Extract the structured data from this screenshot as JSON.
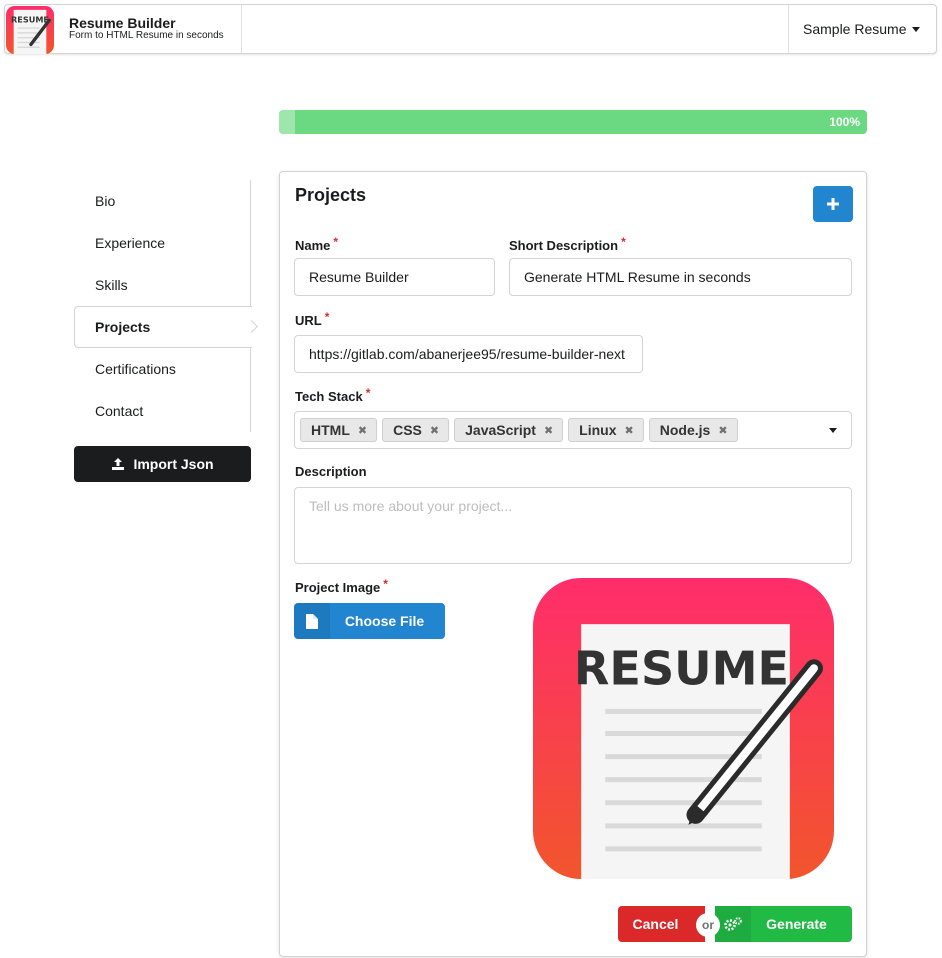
{
  "header": {
    "title": "Resume Builder",
    "subtitle": "Form to HTML Resume in seconds",
    "sample_menu": "Sample Resume",
    "logo_text": "RESUME"
  },
  "progress": {
    "value": 100,
    "label": "100%"
  },
  "sidebar": {
    "items": [
      {
        "label": "Bio"
      },
      {
        "label": "Experience"
      },
      {
        "label": "Skills"
      },
      {
        "label": "Projects",
        "active": true
      },
      {
        "label": "Certifications"
      },
      {
        "label": "Contact"
      }
    ],
    "import_label": "Import Json"
  },
  "form": {
    "title": "Projects",
    "name_label": "Name",
    "name_value": "Resume Builder",
    "short_desc_label": "Short Description",
    "short_desc_value": "Generate HTML Resume in seconds",
    "url_label": "URL",
    "url_value": "https://gitlab.com/abanerjee95/resume-builder-next",
    "tech_label": "Tech Stack",
    "tech_tags": [
      "HTML",
      "CSS",
      "JavaScript",
      "Linux",
      "Node.js"
    ],
    "description_label": "Description",
    "description_placeholder": "Tell us more about your project...",
    "image_label": "Project Image",
    "choose_file_label": "Choose File",
    "required_mark": "*"
  },
  "actions": {
    "cancel": "Cancel",
    "or": "or",
    "generate": "Generate"
  },
  "colors": {
    "primary": "#2185d0",
    "success": "#21ba45",
    "danger": "#db2828",
    "progress": "#6bd982",
    "logo_gradient_top": "#ff2d6b",
    "logo_gradient_bottom": "#f2552c"
  }
}
